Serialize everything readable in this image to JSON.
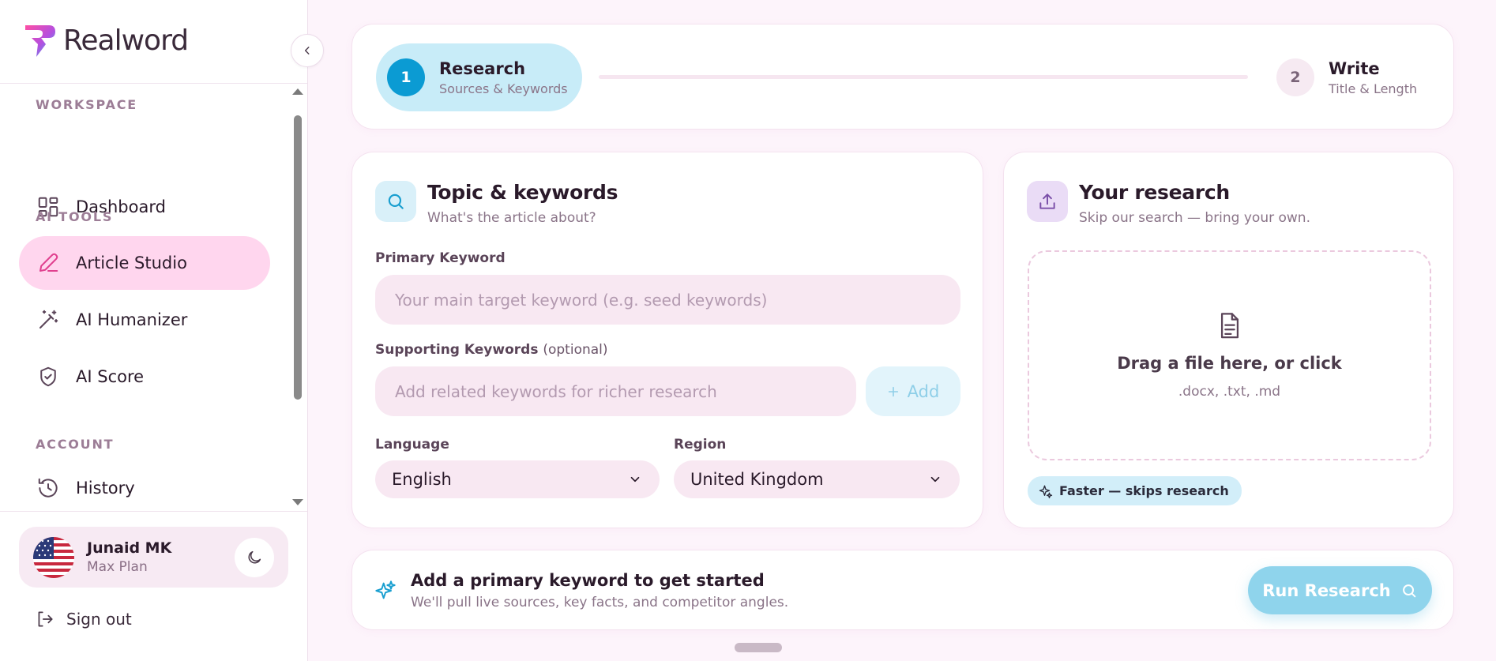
{
  "app": {
    "name": "Realword"
  },
  "sidebar": {
    "sections": {
      "workspace": "WORKSPACE",
      "ai_tools": "AI TOOLS",
      "account": "ACCOUNT"
    },
    "items": {
      "dashboard": "Dashboard",
      "article_studio": "Article Studio",
      "ai_humanizer": "AI Humanizer",
      "ai_score": "AI Score",
      "history": "History"
    },
    "active_item": "Article Studio",
    "user": {
      "name": "Junaid MK",
      "plan": "Max Plan"
    },
    "sign_out": "Sign out"
  },
  "stepper": {
    "steps": [
      {
        "number": "1",
        "title": "Research",
        "subtitle": "Sources & Keywords",
        "active": true
      },
      {
        "number": "2",
        "title": "Write",
        "subtitle": "Title & Length",
        "active": false
      }
    ]
  },
  "topic": {
    "title": "Topic & keywords",
    "subtitle": "What's the article about?",
    "primary_label": "Primary Keyword",
    "primary_placeholder": "Your main target keyword (e.g. seed keywords)",
    "supporting_label": "Supporting Keywords",
    "supporting_optional": "(optional)",
    "supporting_placeholder": "Add related keywords for richer research",
    "add_label": "Add",
    "language_label": "Language",
    "language_value": "English",
    "region_label": "Region",
    "region_value": "United Kingdom"
  },
  "research": {
    "title": "Your research",
    "subtitle": "Skip our search — bring your own.",
    "drop_title": "Drag a file here, or click",
    "drop_formats": ".docx, .txt, .md",
    "badge": "Faster — skips research"
  },
  "cta": {
    "title": "Add a primary keyword to get started",
    "subtitle": "We'll pull live sources, key facts, and competitor angles.",
    "button": "Run Research"
  },
  "colors": {
    "accent_pink": "#ffd6ee",
    "accent_blue": "#0b9bd3",
    "button_blue": "#8fd4ec",
    "background": "#fdf4fb"
  }
}
